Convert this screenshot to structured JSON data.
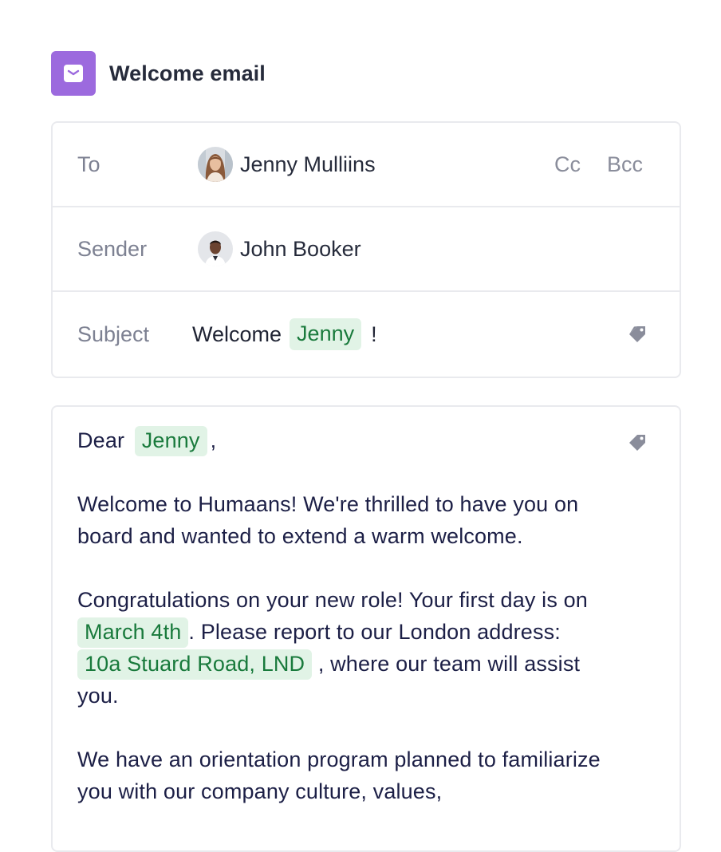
{
  "header": {
    "title": "Welcome email",
    "icon": "mail-icon",
    "icon_color": "#9c6ade"
  },
  "fields": {
    "to": {
      "label": "To",
      "recipient_name": "Jenny Mulliins",
      "cc_label": "Cc",
      "bcc_label": "Bcc"
    },
    "sender": {
      "label": "Sender",
      "name": "John Booker"
    },
    "subject": {
      "label": "Subject",
      "prefix": "Welcome",
      "variable": "Jenny",
      "suffix": "!"
    }
  },
  "body": {
    "greeting_prefix": "Dear",
    "greeting_variable": "Jenny",
    "greeting_suffix": ",",
    "paragraph1": "Welcome to Humaans! We're thrilled to have you on board and wanted to extend a warm welcome.",
    "p2_part1": "Congratulations on your new role! Your first day is on",
    "p2_date": "March 4th",
    "p2_part2": ". Please report to our London address:",
    "p2_address": "10a Stuard Road, LND",
    "p2_part3": ", where our team will assist you.",
    "paragraph3": "We have an orientation program planned to familiarize you with our company culture, values,"
  },
  "colors": {
    "variable_chip_bg": "#e1f3e6",
    "variable_chip_text": "#197a3c",
    "border": "#e9eaee",
    "label": "#7d8192"
  }
}
